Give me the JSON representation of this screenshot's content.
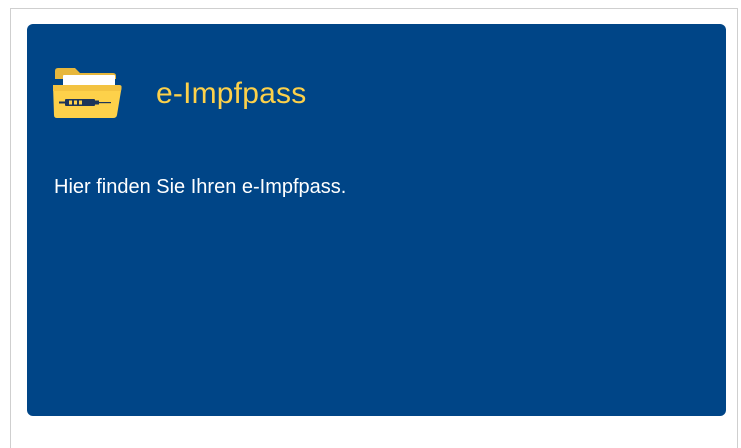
{
  "card": {
    "title": "e-Impfpass",
    "description": "Hier finden Sie Ihren e-Impfpass.",
    "icon": "folder-syringe-icon",
    "colors": {
      "background": "#004587",
      "accent": "#fdd14a",
      "text": "#ffffff"
    }
  }
}
